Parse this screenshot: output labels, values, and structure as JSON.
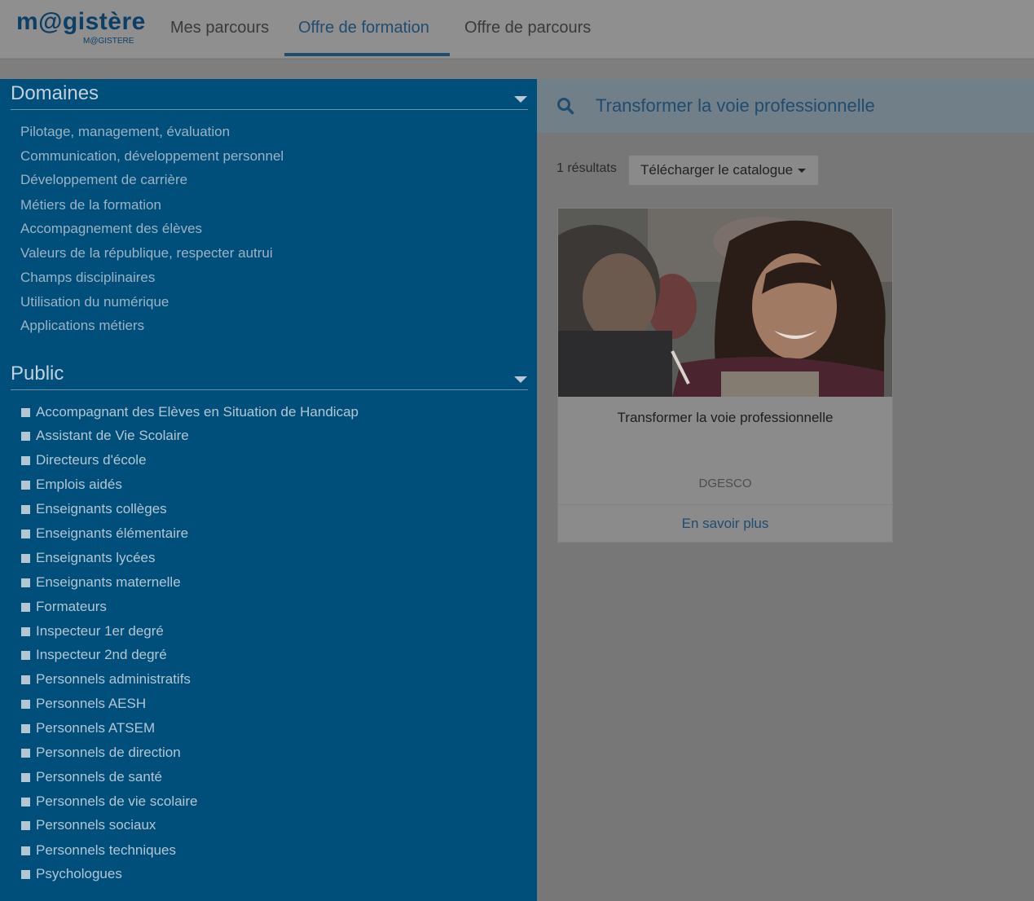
{
  "header": {
    "logo_main": "m@gistère",
    "logo_sub": "M@GISTERE",
    "nav": [
      {
        "label": "Mes parcours",
        "active": false
      },
      {
        "label": "Offre de formation",
        "active": true
      },
      {
        "label": "Offre de parcours",
        "active": false
      }
    ]
  },
  "sidebar": {
    "domaines": {
      "title": "Domaines",
      "items": [
        "Pilotage, management, évaluation",
        "Communication, développement personnel",
        "Développement de carrière",
        "Métiers de la formation",
        "Accompagnement des élèves",
        "Valeurs de la république, respecter autrui",
        "Champs disciplinaires",
        "Utilisation du numérique",
        "Applications métiers"
      ]
    },
    "public": {
      "title": "Public",
      "items": [
        "Accompagnant des Elèves en Situation de Handicap",
        "Assistant de Vie Scolaire",
        "Directeurs d'école",
        "Emplois aidés",
        "Enseignants collèges",
        "Enseignants élémentaire",
        "Enseignants lycées",
        "Enseignants maternelle",
        "Formateurs",
        "Inspecteur 1er degré",
        "Inspecteur 2nd degré",
        "Personnels administratifs",
        "Personnels AESH",
        "Personnels ATSEM",
        "Personnels de direction",
        "Personnels de santé",
        "Personnels de vie scolaire",
        "Personnels sociaux",
        "Personnels techniques",
        "Psychologues"
      ]
    }
  },
  "search": {
    "icon": "search-icon",
    "query": "Transformer la voie professionnelle"
  },
  "results": {
    "count_label": "1 résultats",
    "download_label": "Télécharger le catalogue"
  },
  "card": {
    "title": "Transformer la voie professionnelle",
    "organization": "DGESCO",
    "link_label": "En savoir plus"
  },
  "colors": {
    "sidebar_bg": "#004f7b",
    "accent": "#1f4c6f",
    "overlay_gray": "#777777"
  }
}
